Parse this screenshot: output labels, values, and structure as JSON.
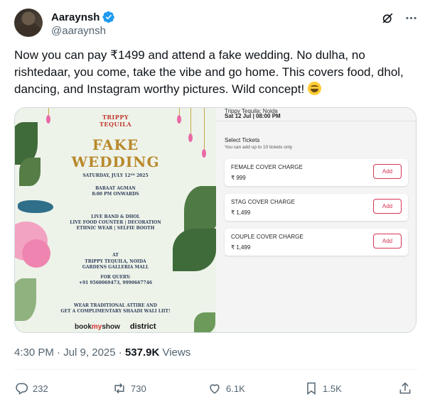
{
  "author": {
    "display_name": "Aaraynsh",
    "handle": "@aaraynsh",
    "verified": true
  },
  "header_icons": [
    "grok-icon",
    "more-icon"
  ],
  "tweet": {
    "text": "Now you can pay ₹1499 and attend a fake wedding. No dulha, no rishtedaar, you come, take the vibe and go home. This covers food, dhol, dancing, and Instagram worthy pictures. Wild concept! ",
    "emoji": "rolling-on-floor-laughing"
  },
  "poster": {
    "brand_line1": "TRIPPY",
    "brand_line2": "TEQUILA",
    "title_line1": "FAKE",
    "title_line2": "WEDDING",
    "date": "SATURDAY, JULY 12ᵀᴴ 2025",
    "baraat_label": "BARAAT AGMAN",
    "baraat_time": "8:00 PM ONWARDS",
    "features_1": "LIVE BAND & DHOL",
    "features_2": "LIVE FOOD COUNTER | DECORATION",
    "features_3": "ETHNIC WEAR | SELFIE BOOTH",
    "at": "AT",
    "venue_1": "TRIPPY TEQUILA, NOIDA",
    "venue_2": "GARDENS GALLERIA MALL",
    "query_label": "FOR QUERY:",
    "phones": "+91 9560069473, 9990667746",
    "footer_1": "WEAR TRADITIONAL ATTIRE AND",
    "footer_2": "GET A COMPLIMENTARY SHAADI WALI LIIT!",
    "logo_bms_1": "book",
    "logo_bms_2": "my",
    "logo_bms_3": "show",
    "logo_district": "district"
  },
  "ticket_app": {
    "venue": "Trippy Tequila: Noida",
    "datetime": "Sat 12 Jul | 08:00 PM",
    "select_title": "Select Tickets",
    "select_sub": "You can add up to 10 tickets only",
    "tickets": [
      {
        "name": "FEMALE COVER CHARGE",
        "price": "₹ 999",
        "button": "Add"
      },
      {
        "name": "STAG COVER CHARGE",
        "price": "₹ 1,499",
        "button": "Add"
      },
      {
        "name": "COUPLE COVER CHARGE",
        "price": "₹ 1,499",
        "button": "Add"
      }
    ],
    "accent_color": "#d63553"
  },
  "meta": {
    "time": "4:30 PM",
    "sep": " · ",
    "date": "Jul 9, 2025",
    "sep2": " · ",
    "views_count": "537.9K",
    "views_label": " Views"
  },
  "actions": {
    "replies": "232",
    "reposts": "730",
    "likes": "6.1K",
    "bookmarks": "1.5K"
  },
  "colors": {
    "text_primary": "#0f1419",
    "text_secondary": "#536471",
    "verified_blue": "#1d9bf0",
    "border": "#cfd9de"
  }
}
